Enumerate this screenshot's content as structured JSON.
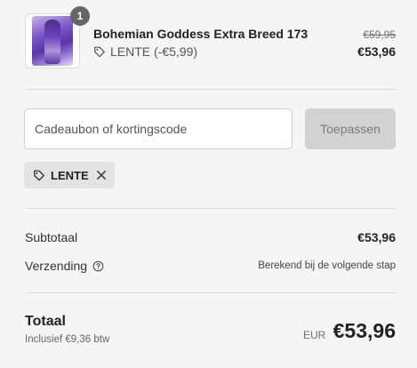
{
  "line_item": {
    "quantity": "1",
    "name": "Bohemian Goddess Extra Breed 173",
    "discount_text": "LENTE (-€5,99)",
    "original_price": "€59,95",
    "price": "€53,96",
    "thumbnail": "product-thumbnail"
  },
  "discount": {
    "placeholder": "Cadeaubon of kortingscode",
    "apply_label": "Toepassen",
    "applied_code": "LENTE"
  },
  "summary": {
    "subtotal_label": "Subtotaal",
    "subtotal_value": "€53,96",
    "shipping_label": "Verzending",
    "shipping_value": "Berekend bij de volgende stap"
  },
  "total": {
    "label": "Totaal",
    "tax_note": "Inclusief €9,36 btw",
    "currency": "EUR",
    "amount": "€53,96"
  },
  "icons": {
    "tag": "tag-icon",
    "remove": "close-icon",
    "help": "question-circle-icon"
  },
  "colors": {
    "background": "#f5f5f5",
    "badge": "#666666",
    "button_disabled": "#d2d2d2",
    "chip": "#e3e3e3"
  }
}
